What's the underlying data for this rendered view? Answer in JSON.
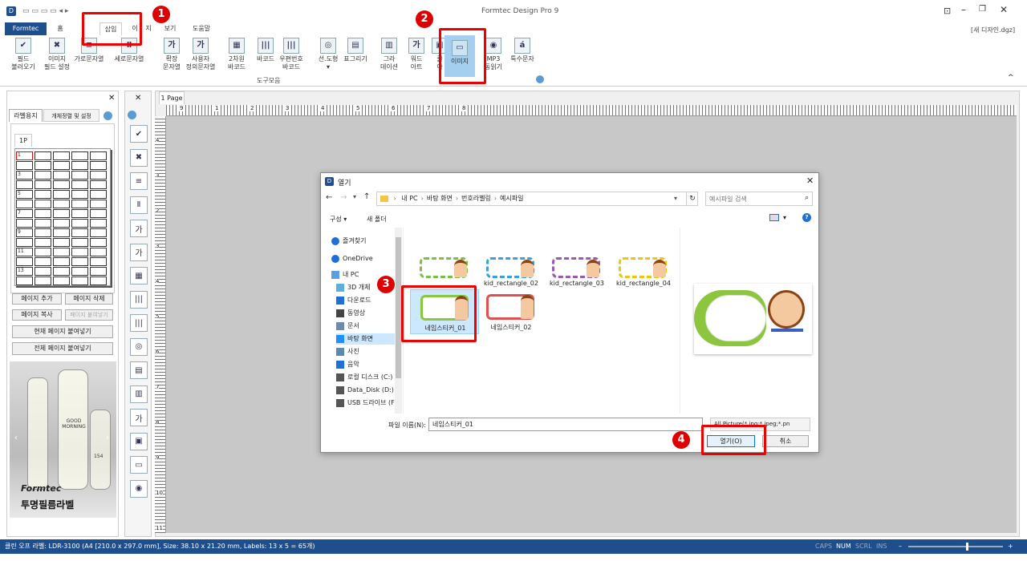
{
  "window": {
    "title": "Formtec Design Pro 9",
    "doc_name": "[새 디자인.dgz]"
  },
  "tabs": [
    "Formtec",
    "홈",
    "",
    "삽입",
    "이",
    "지",
    "보기",
    "도움말"
  ],
  "ribbon": {
    "group_label": "도구모음",
    "buttons": [
      {
        "icon": "✔",
        "label": "필드\n불러오기"
      },
      {
        "icon": "✖",
        "label": "이미지\n필드 설정"
      },
      {
        "icon": "≡",
        "label": "가로문자열"
      },
      {
        "icon": "Ⅱ",
        "label": "세로문자열"
      },
      {
        "icon": "가",
        "label": "확장\n문자열"
      },
      {
        "icon": "가",
        "label": "사용자\n정의문자열"
      },
      {
        "icon": "▦",
        "label": "2차원\n바코드"
      },
      {
        "icon": "|||",
        "label": "바코드"
      },
      {
        "icon": "|||",
        "label": "우편번호\n바코드"
      },
      {
        "icon": "◎",
        "label": "선.도형\n▾"
      },
      {
        "icon": "▤",
        "label": "표그리기"
      },
      {
        "icon": "▥",
        "label": "그라\n데이션"
      },
      {
        "icon": "가",
        "label": "워드\n아트"
      },
      {
        "icon": "▣",
        "label": "클\n아"
      },
      {
        "icon": "▭",
        "label": "이미지"
      },
      {
        "icon": "◉",
        "label": "MP3\n동읽기"
      },
      {
        "icon": "á",
        "label": "특수문자"
      }
    ]
  },
  "left_panel": {
    "tabs": [
      "라벨용지",
      "개체정렬 및 설정"
    ],
    "page_tab": "1P",
    "row_labels": [
      "1",
      "3",
      "5",
      "7",
      "9",
      "11",
      "13"
    ],
    "buttons": [
      "페이지 추가",
      "페이지 삭제",
      "페이지 복사",
      "페이지 붙여넣기",
      "현재 페이지 붙여넣기",
      "전체 페이지 붙여넣기"
    ],
    "ad": {
      "bottle_text": "GOOD\nMORNING",
      "brand": "Formtec",
      "caption": "투명필름라벨",
      "number": "154"
    }
  },
  "vertical_toolbar": [
    "✔",
    "✖",
    "≡",
    "Ⅱ",
    "가",
    "가",
    "▦",
    "|||",
    "|||",
    "◎",
    "▤",
    "▥",
    "가",
    "▣",
    "▭",
    "◉"
  ],
  "workspace": {
    "page_tab": "1 Page",
    "ruler_marks": [
      "9",
      "1",
      "2",
      "3",
      "4",
      "5",
      "6",
      "7",
      "8"
    ],
    "vruler_marks": [
      "4",
      "3",
      "2",
      "3",
      "4",
      "5",
      "6",
      "7",
      "8",
      "9",
      "10",
      "11"
    ]
  },
  "dialog": {
    "title": "열기",
    "path": [
      "내 PC",
      "바탕 화면",
      "번호라벨링",
      "예시파일"
    ],
    "search_placeholder": "예시파일 검색",
    "toolbar": {
      "organize": "구성 ▾",
      "new_folder": "새 폴더"
    },
    "nav": [
      {
        "label": "즐겨찾기",
        "icon": "star"
      },
      {
        "label": "OneDrive",
        "icon": "cloud"
      },
      {
        "label": "내 PC",
        "icon": "pc"
      },
      {
        "label": "3D 개체",
        "icon": "cube"
      },
      {
        "label": "다운로드",
        "icon": "download"
      },
      {
        "label": "동영상",
        "icon": "video"
      },
      {
        "label": "문서",
        "icon": "doc"
      },
      {
        "label": "바탕 화면",
        "icon": "desktop"
      },
      {
        "label": "사진",
        "icon": "photo"
      },
      {
        "label": "음악",
        "icon": "music"
      },
      {
        "label": "로컬 디스크 (C:)",
        "icon": "disk"
      },
      {
        "label": "Data_Disk (D:)",
        "icon": "disk"
      },
      {
        "label": "USB 드라이브 (F",
        "icon": "usb"
      }
    ],
    "files": [
      {
        "name": "",
        "color": "#7ac143"
      },
      {
        "name": "kid_rectangle_02",
        "color": "#3aa0e0"
      },
      {
        "name": "kid_rectangle_03",
        "color": "#9b59b6"
      },
      {
        "name": "kid_rectangle_04",
        "color": "#f1c40f"
      },
      {
        "name": "네임스티커_01",
        "color": "#8cc63f"
      },
      {
        "name": "네임스티커_02",
        "color": "#e05050"
      }
    ],
    "filename_label": "파일 이름(N):",
    "filename_value": "네임스티커_01",
    "filetype": "All Picture(*.jpg;*.jpeg;*.pn",
    "open_button": "열기(O)",
    "cancel_button": "취소"
  },
  "badges": [
    "1",
    "2",
    "3",
    "4"
  ],
  "status": {
    "text": "클린 오프 라벨: LDR-3100 (A4 [210.0 x 297.0 mm], Size: 38.10 x 21.20 mm,  Labels: 13 x 5 = 65개)",
    "indicators": [
      "CAPS",
      "NUM",
      "SCRL",
      "INS"
    ]
  },
  "colors": {
    "accent": "#1f4e8c",
    "highlight": "#e00000",
    "selected": "#cce8ff"
  }
}
